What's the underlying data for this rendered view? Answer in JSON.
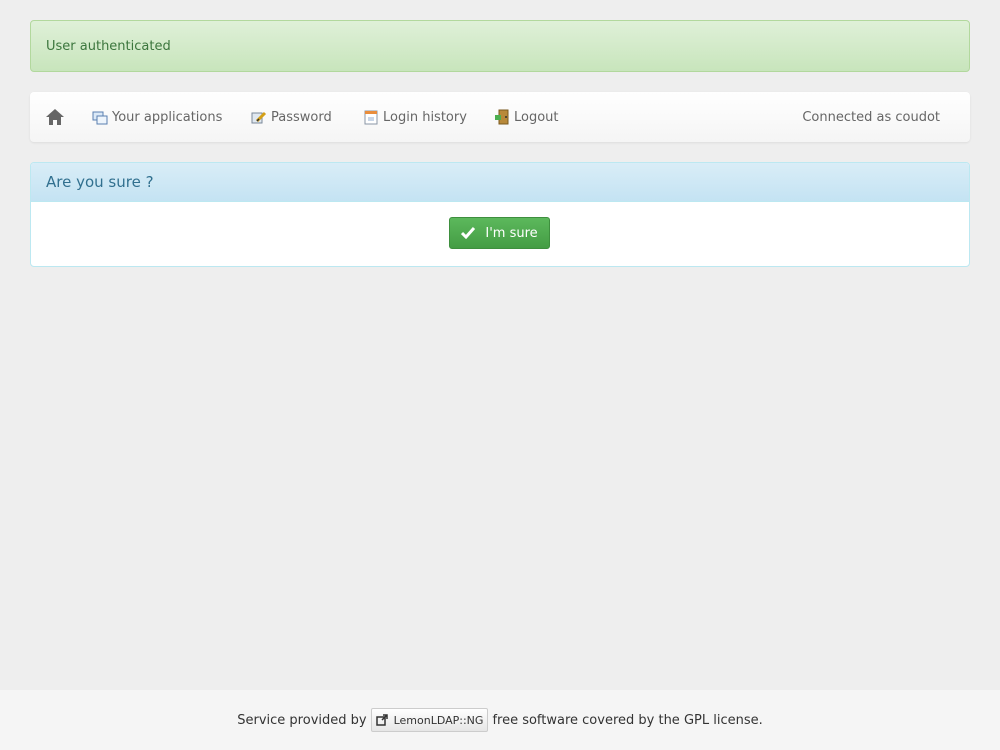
{
  "alert": {
    "message": "User authenticated"
  },
  "navbar": {
    "home_icon": "home-icon",
    "items": [
      {
        "label": "Your applications",
        "icon": "applications-icon"
      },
      {
        "label": "Password",
        "icon": "password-icon"
      },
      {
        "label": "Login history",
        "icon": "calendar-icon"
      },
      {
        "label": "Logout",
        "icon": "logout-door-icon"
      }
    ],
    "connected_text": "Connected as coudot"
  },
  "panel": {
    "heading": "Are you sure ?",
    "button_label": "I'm sure",
    "button_icon": "checkmark-icon"
  },
  "footer": {
    "prefix": "Service provided by",
    "link_label": "LemonLDAP::NG",
    "link_icon": "external-link-icon",
    "suffix": "free software covered by the GPL license."
  },
  "colors": {
    "success_bg": "#dff0d8",
    "info_heading_bg": "#d9edf7",
    "button_green": "#5cb85c",
    "page_bg": "#eeeeee"
  }
}
